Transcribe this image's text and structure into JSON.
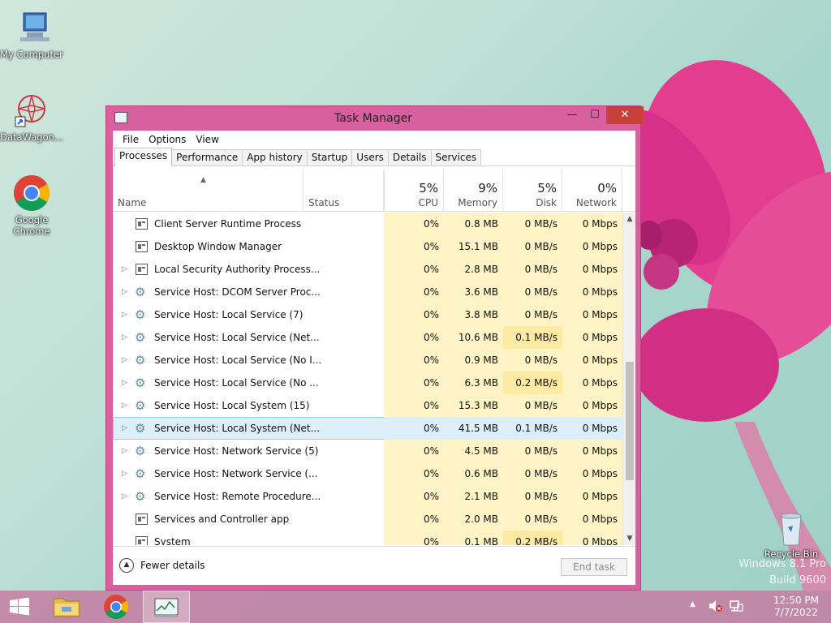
{
  "desktop": {
    "icons": [
      {
        "label": "My Computer"
      },
      {
        "label": "DataWagon..."
      },
      {
        "label": "Google Chrome"
      },
      {
        "label": "Recycle Bin"
      }
    ],
    "watermark_line1": "Windows 8.1 Pro",
    "watermark_line2": "Build 9600"
  },
  "window": {
    "title": "Task Manager",
    "min_glyph": "—",
    "max_glyph": "☐",
    "close_glyph": "✕"
  },
  "menu": [
    "File",
    "Options",
    "View"
  ],
  "tabs": [
    "Processes",
    "Performance",
    "App history",
    "Startup",
    "Users",
    "Details",
    "Services"
  ],
  "columns": {
    "name": "Name",
    "status": "Status",
    "cpu": {
      "pct": "5%",
      "label": "CPU"
    },
    "memory": {
      "pct": "9%",
      "label": "Memory"
    },
    "disk": {
      "pct": "5%",
      "label": "Disk"
    },
    "network": {
      "pct": "0%",
      "label": "Network"
    }
  },
  "processes": [
    {
      "name": "Client Server Runtime Process",
      "expand": false,
      "icon": "window-icon",
      "cpu": "0%",
      "mem": "0.8 MB",
      "disk": "0 MB/s",
      "net": "0 Mbps"
    },
    {
      "name": "Desktop Window Manager",
      "expand": false,
      "icon": "window-icon",
      "cpu": "0%",
      "mem": "15.1 MB",
      "disk": "0 MB/s",
      "net": "0 Mbps"
    },
    {
      "name": "Local Security Authority Process...",
      "expand": true,
      "icon": "window-icon",
      "cpu": "0%",
      "mem": "2.8 MB",
      "disk": "0 MB/s",
      "net": "0 Mbps"
    },
    {
      "name": "Service Host: DCOM Server Proc...",
      "expand": true,
      "icon": "gear-icon",
      "cpu": "0%",
      "mem": "3.6 MB",
      "disk": "0 MB/s",
      "net": "0 Mbps"
    },
    {
      "name": "Service Host: Local Service (7)",
      "expand": true,
      "icon": "gear-icon",
      "cpu": "0%",
      "mem": "3.8 MB",
      "disk": "0 MB/s",
      "net": "0 Mbps"
    },
    {
      "name": "Service Host: Local Service (Net...",
      "expand": true,
      "icon": "gear-icon",
      "cpu": "0%",
      "mem": "10.6 MB",
      "disk": "0.1 MB/s",
      "net": "0 Mbps"
    },
    {
      "name": "Service Host: Local Service (No I...",
      "expand": true,
      "icon": "gear-icon",
      "cpu": "0%",
      "mem": "0.9 MB",
      "disk": "0 MB/s",
      "net": "0 Mbps"
    },
    {
      "name": "Service Host: Local Service (No ...",
      "expand": true,
      "icon": "gear-icon",
      "cpu": "0%",
      "mem": "6.3 MB",
      "disk": "0.2 MB/s",
      "net": "0 Mbps"
    },
    {
      "name": "Service Host: Local System (15)",
      "expand": true,
      "icon": "gear-icon",
      "cpu": "0%",
      "mem": "15.3 MB",
      "disk": "0 MB/s",
      "net": "0 Mbps"
    },
    {
      "name": "Service Host: Local System (Net...",
      "expand": true,
      "icon": "gear-icon",
      "cpu": "0%",
      "mem": "41.5 MB",
      "disk": "0.1 MB/s",
      "net": "0 Mbps",
      "selected": true
    },
    {
      "name": "Service Host: Network Service (5)",
      "expand": true,
      "icon": "gear-icon",
      "cpu": "0%",
      "mem": "4.5 MB",
      "disk": "0 MB/s",
      "net": "0 Mbps"
    },
    {
      "name": "Service Host: Network Service (...",
      "expand": true,
      "icon": "gear-icon",
      "cpu": "0%",
      "mem": "0.6 MB",
      "disk": "0 MB/s",
      "net": "0 Mbps"
    },
    {
      "name": "Service Host: Remote Procedure...",
      "expand": true,
      "icon": "gear-icon",
      "cpu": "0%",
      "mem": "2.1 MB",
      "disk": "0 MB/s",
      "net": "0 Mbps"
    },
    {
      "name": "Services and Controller app",
      "expand": false,
      "icon": "window-icon",
      "cpu": "0%",
      "mem": "2.0 MB",
      "disk": "0 MB/s",
      "net": "0 Mbps"
    },
    {
      "name": "System",
      "expand": false,
      "icon": "window-icon",
      "cpu": "0%",
      "mem": "0.1 MB",
      "disk": "0.2 MB/s",
      "net": "0 Mbps"
    }
  ],
  "footer": {
    "fewer_details": "Fewer details",
    "end_task": "End task"
  },
  "taskbar": {
    "time": "12:50 PM",
    "date": "7/7/2022"
  },
  "colors": {
    "window_border": "#d9609f",
    "close_button": "#c7403a",
    "heat_cell": "#fff4c6",
    "selected_row": "#dceffa"
  }
}
